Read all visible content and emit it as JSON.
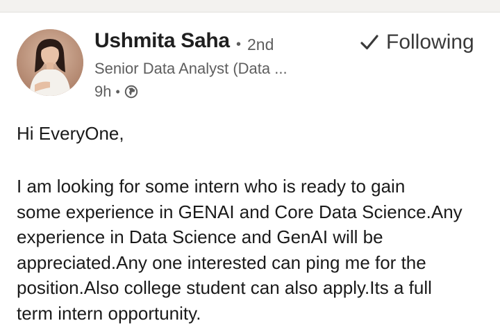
{
  "post": {
    "author": {
      "name": "Ushmita Saha",
      "separator": "•",
      "degree": "2nd",
      "headline": "Senior Data Analyst (Data ...",
      "time": "9h",
      "time_separator": "•",
      "visibility_icon": "globe-icon",
      "avatar_icon": "profile-photo"
    },
    "follow": {
      "icon": "check-icon",
      "label": "Following"
    },
    "greeting": "Hi EveryOne,",
    "message_lines": [
      "I am looking for some intern who is ready to gain",
      "some experience in GENAI and Core Data Science.Any",
      "experience in Data Science and GenAI will be",
      "appreciated.Any one interested can ping me for the",
      "position.Also college student can also apply.Its a full",
      "term intern opportunity."
    ]
  },
  "colors": {
    "name": "#1f1f1f",
    "secondary": "#5e5e5e",
    "body": "#1a1a1a",
    "background": "#ffffff",
    "feed_background": "#f3f2ef"
  }
}
